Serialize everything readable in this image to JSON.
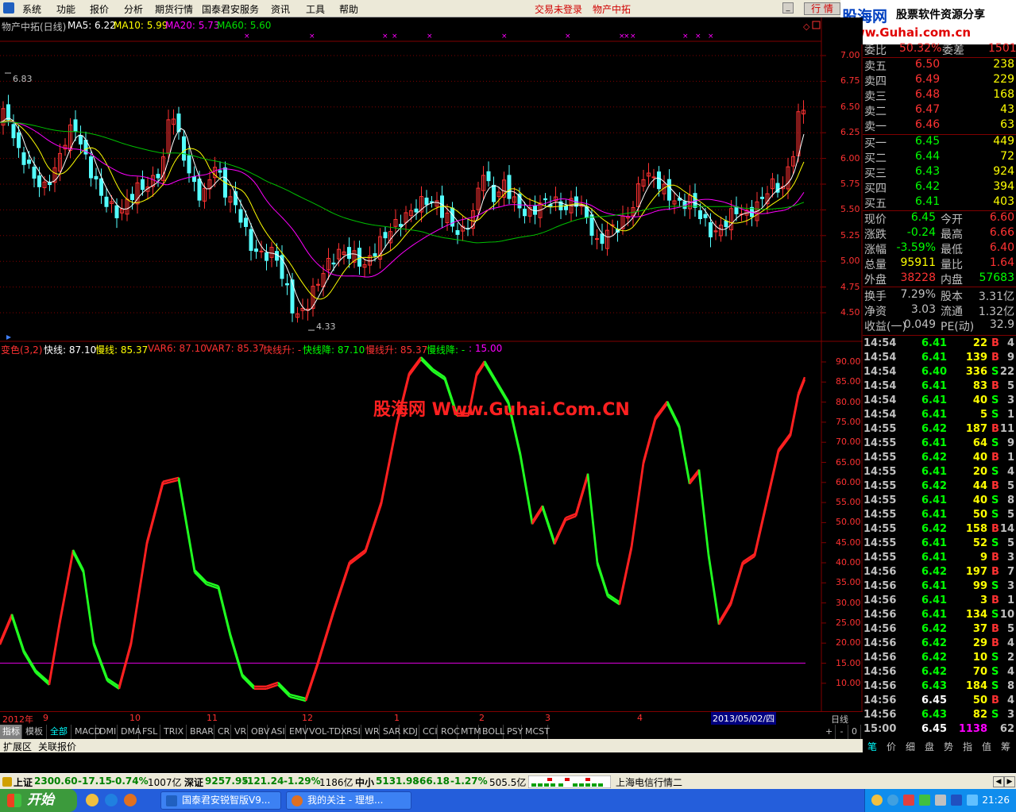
{
  "menu": [
    "系统",
    "功能",
    "报价",
    "分析",
    "期货行情",
    "国泰君安服务",
    "资讯",
    "工具",
    "帮助"
  ],
  "menu_notice": {
    "login": "交易未登录",
    "stock": "物产中拓"
  },
  "hq_tab": "行 情",
  "logo": {
    "brand": "股海网",
    "slogan": "股票软件资源分享",
    "url": "www.Guhai.com.cn"
  },
  "kline": {
    "title": "物产中拓(日线)",
    "ma5": "MA5: 6.22",
    "ma10": "MA10: 5.99",
    "ma20": "MA20: 5.73",
    "ma60": "MA60: 5.60",
    "hi_label": "6.83",
    "lo_label": "4.33",
    "yticks": [
      "7.00",
      "6.75",
      "6.50",
      "6.25",
      "6.00",
      "5.75",
      "5.50",
      "5.25",
      "5.00",
      "4.75",
      "4.50"
    ]
  },
  "indicator": {
    "name": "变色(3,2)",
    "fast": "快线: 87.10",
    "slow": "慢线: 85.37",
    "var6": "VAR6: 87.10",
    "var7": "VAR7: 85.37",
    "fast_up": "快线升: -",
    "fast_down": "快线降: 87.10",
    "slow_up": "慢线升: 85.37",
    "slow_down": "慢线降: -",
    "level": ": 15.00",
    "yticks": [
      "90.00",
      "85.00",
      "80.00",
      "75.00",
      "70.00",
      "65.00",
      "60.00",
      "55.00",
      "50.00",
      "45.00",
      "40.00",
      "35.00",
      "30.00",
      "25.00",
      "20.00",
      "15.00",
      "10.00"
    ]
  },
  "watermark": "股海网 Www.Guhai.Com.CN",
  "dateaxis": {
    "items": [
      "2012年",
      "9",
      "10",
      "11",
      "12",
      "1",
      "2",
      "3",
      "4"
    ],
    "cursor": "2013/05/02/四",
    "period": "日线"
  },
  "indicator_tabs": [
    "指标",
    "模板",
    "全部",
    "MACD",
    "DMI",
    "DMA",
    "FSL",
    "TRIX",
    "BRAR",
    "CR",
    "VR",
    "OBV",
    "ASI",
    "EMV",
    "VOL-TDX",
    "RSI",
    "WR",
    "SAR",
    "KDJ",
    "CCI",
    "ROC",
    "MTM",
    "BOLL",
    "PSY",
    "MCST"
  ],
  "ext_tabs": [
    "扩展区",
    "关联报价"
  ],
  "quote": {
    "weibi": {
      "l1": "委比",
      "v1": "50.32%",
      "l2": "委差",
      "v2": "1501"
    },
    "asks": [
      {
        "label": "卖五",
        "price": "6.50",
        "vol": "238"
      },
      {
        "label": "卖四",
        "price": "6.49",
        "vol": "229"
      },
      {
        "label": "卖三",
        "price": "6.48",
        "vol": "168"
      },
      {
        "label": "卖二",
        "price": "6.47",
        "vol": "43"
      },
      {
        "label": "卖一",
        "price": "6.46",
        "vol": "63"
      }
    ],
    "bids": [
      {
        "label": "买一",
        "price": "6.45",
        "vol": "449"
      },
      {
        "label": "买二",
        "price": "6.44",
        "vol": "72"
      },
      {
        "label": "买三",
        "price": "6.43",
        "vol": "924"
      },
      {
        "label": "买四",
        "price": "6.42",
        "vol": "394"
      },
      {
        "label": "买五",
        "price": "6.41",
        "vol": "403"
      }
    ],
    "stats": [
      {
        "l1": "现价",
        "v1": "6.45",
        "l2": "今开",
        "v2": "6.60"
      },
      {
        "l1": "涨跌",
        "v1": "-0.24",
        "l2": "最高",
        "v2": "6.66"
      },
      {
        "l1": "涨幅",
        "v1": "-3.59%",
        "l2": "最低",
        "v2": "6.40"
      },
      {
        "l1": "总量",
        "v1": "95911",
        "l2": "量比",
        "v2": "1.64"
      },
      {
        "l1": "外盘",
        "v1": "38228",
        "l2": "内盘",
        "v2": "57683"
      },
      {
        "l1": "换手",
        "v1": "7.29%",
        "l2": "股本",
        "v2": "3.31亿"
      },
      {
        "l1": "净资",
        "v1": "3.03",
        "l2": "流通",
        "v2": "1.32亿"
      },
      {
        "l1": "收益(一)",
        "v1": "0.049",
        "l2": "PE(动)",
        "v2": "32.9"
      }
    ]
  },
  "ticks": [
    {
      "t": "14:54",
      "p": "6.41",
      "v": "22",
      "s": "B",
      "n": "4"
    },
    {
      "t": "14:54",
      "p": "6.41",
      "v": "139",
      "s": "B",
      "n": "9"
    },
    {
      "t": "14:54",
      "p": "6.40",
      "v": "336",
      "s": "S",
      "n": "22"
    },
    {
      "t": "14:54",
      "p": "6.41",
      "v": "83",
      "s": "B",
      "n": "5"
    },
    {
      "t": "14:54",
      "p": "6.41",
      "v": "40",
      "s": "S",
      "n": "3"
    },
    {
      "t": "14:54",
      "p": "6.41",
      "v": "5",
      "s": "S",
      "n": "1"
    },
    {
      "t": "14:55",
      "p": "6.42",
      "v": "187",
      "s": "B",
      "n": "11"
    },
    {
      "t": "14:55",
      "p": "6.41",
      "v": "64",
      "s": "S",
      "n": "9"
    },
    {
      "t": "14:55",
      "p": "6.42",
      "v": "40",
      "s": "B",
      "n": "1"
    },
    {
      "t": "14:55",
      "p": "6.41",
      "v": "20",
      "s": "S",
      "n": "4"
    },
    {
      "t": "14:55",
      "p": "6.42",
      "v": "44",
      "s": "B",
      "n": "5"
    },
    {
      "t": "14:55",
      "p": "6.41",
      "v": "40",
      "s": "S",
      "n": "8"
    },
    {
      "t": "14:55",
      "p": "6.41",
      "v": "50",
      "s": "S",
      "n": "5"
    },
    {
      "t": "14:55",
      "p": "6.42",
      "v": "158",
      "s": "B",
      "n": "14"
    },
    {
      "t": "14:55",
      "p": "6.41",
      "v": "52",
      "s": "S",
      "n": "5"
    },
    {
      "t": "14:55",
      "p": "6.41",
      "v": "9",
      "s": "B",
      "n": "3"
    },
    {
      "t": "14:56",
      "p": "6.42",
      "v": "197",
      "s": "B",
      "n": "7"
    },
    {
      "t": "14:56",
      "p": "6.41",
      "v": "99",
      "s": "S",
      "n": "3"
    },
    {
      "t": "14:56",
      "p": "6.41",
      "v": "3",
      "s": "B",
      "n": "1"
    },
    {
      "t": "14:56",
      "p": "6.41",
      "v": "134",
      "s": "S",
      "n": "10"
    },
    {
      "t": "14:56",
      "p": "6.42",
      "v": "37",
      "s": "B",
      "n": "5"
    },
    {
      "t": "14:56",
      "p": "6.42",
      "v": "29",
      "s": "B",
      "n": "4"
    },
    {
      "t": "14:56",
      "p": "6.42",
      "v": "10",
      "s": "S",
      "n": "2"
    },
    {
      "t": "14:56",
      "p": "6.42",
      "v": "70",
      "s": "S",
      "n": "4"
    },
    {
      "t": "14:56",
      "p": "6.43",
      "v": "184",
      "s": "S",
      "n": "8"
    },
    {
      "t": "14:56",
      "p": "6.45",
      "v": "50",
      "s": "B",
      "n": "4"
    },
    {
      "t": "14:56",
      "p": "6.43",
      "v": "82",
      "s": "S",
      "n": "3"
    },
    {
      "t": "15:00",
      "p": "6.45",
      "v": "1138",
      "s": "",
      "n": "62"
    }
  ],
  "right_tabs": [
    "笔",
    "价",
    "细",
    "盘",
    "势",
    "指",
    "值",
    "筹"
  ],
  "status": {
    "sh": {
      "name": "上证",
      "val": "2300.60",
      "chg": "-17.15",
      "pct": "-0.74%",
      "amt": "1007亿"
    },
    "sz": {
      "name": "深证",
      "val": "9257.95",
      "chg": "-121.24",
      "pct": "-1.29%",
      "amt": "1186亿"
    },
    "zx": {
      "name": "中小",
      "val": "5131.98",
      "chg": "-66.18",
      "pct": "-1.27%",
      "amt": "505.5亿"
    },
    "ticker": "上海电信行情二"
  },
  "taskbar": {
    "start": "开始",
    "tasks": [
      "国泰君安锐智版V9...",
      "我的关注 - 理想..."
    ],
    "clock": "21:26"
  },
  "colors": {
    "up": "#ff3232",
    "down": "#54ffff",
    "ma5": "#ffffff",
    "ma10": "#ffff00",
    "ma20": "#ff00ff",
    "ma60": "#00c000",
    "fast": "#ff2020",
    "slow": "#20ff20",
    "level": "#c000c0"
  }
}
